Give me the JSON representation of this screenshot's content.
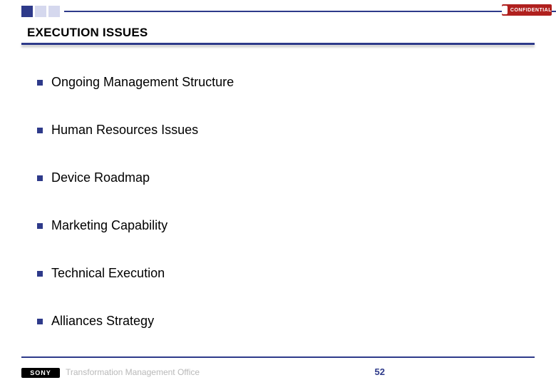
{
  "badge": {
    "text": "CONFIDENTIAL"
  },
  "title": "EXECUTION ISSUES",
  "bullets": [
    "Ongoing Management Structure",
    "Human Resources Issues",
    "Device Roadmap",
    "Marketing Capability",
    "Technical Execution",
    "Alliances Strategy"
  ],
  "footer": {
    "logo": "SONY",
    "text": "Transformation Management Office",
    "page": "52"
  }
}
